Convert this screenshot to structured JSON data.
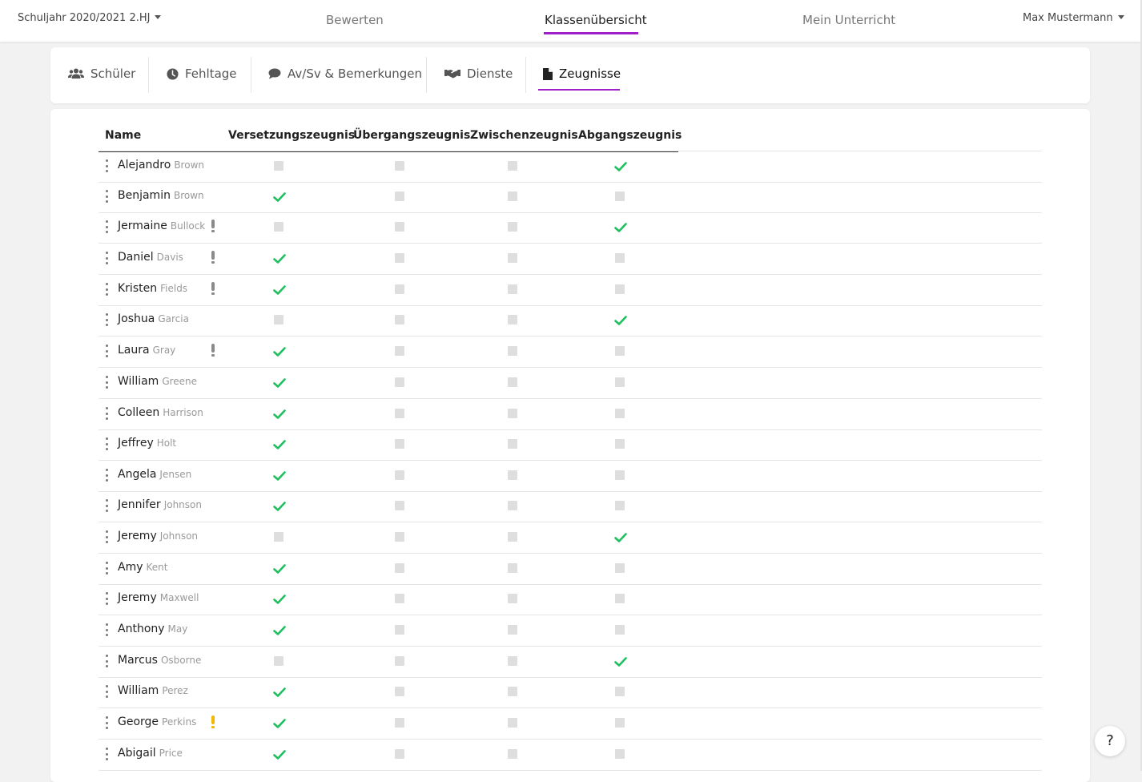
{
  "header": {
    "school_year": "Schuljahr 2020/2021 2.HJ",
    "nav": [
      "Bewerten",
      "Klassenübersicht",
      "Mein Unterricht"
    ],
    "active_nav": "Klassenübersicht",
    "user": "Max Mustermann"
  },
  "tabs": [
    {
      "label": "Schüler",
      "icon": "users-icon"
    },
    {
      "label": "Fehltage",
      "icon": "clock-icon"
    },
    {
      "label": "Av/Sv & Bemerkungen",
      "icon": "comment-icon"
    },
    {
      "label": "Dienste",
      "icon": "handshake-icon"
    },
    {
      "label": "Zeugnisse",
      "icon": "document-icon"
    }
  ],
  "active_tab": "Zeugnisse",
  "table": {
    "columns": [
      "Name",
      "Versetzungszeugnis",
      "Übergangszeugnis",
      "Zwischenzeugnis",
      "Abgangszeugnis"
    ],
    "rows": [
      {
        "first": "Alejandro",
        "last": "Brown",
        "warning": null,
        "certs": [
          false,
          false,
          false,
          true
        ]
      },
      {
        "first": "Benjamin",
        "last": "Brown",
        "warning": null,
        "certs": [
          true,
          false,
          false,
          false
        ]
      },
      {
        "first": "Jermaine",
        "last": "Bullock",
        "warning": "gray",
        "certs": [
          false,
          false,
          false,
          true
        ]
      },
      {
        "first": "Daniel",
        "last": "Davis",
        "warning": "gray",
        "certs": [
          true,
          false,
          false,
          false
        ]
      },
      {
        "first": "Kristen",
        "last": "Fields",
        "warning": "gray",
        "certs": [
          true,
          false,
          false,
          false
        ]
      },
      {
        "first": "Joshua",
        "last": "Garcia",
        "warning": null,
        "certs": [
          false,
          false,
          false,
          true
        ]
      },
      {
        "first": "Laura",
        "last": "Gray",
        "warning": "gray",
        "certs": [
          true,
          false,
          false,
          false
        ]
      },
      {
        "first": "William",
        "last": "Greene",
        "warning": null,
        "certs": [
          true,
          false,
          false,
          false
        ]
      },
      {
        "first": "Colleen",
        "last": "Harrison",
        "warning": null,
        "certs": [
          true,
          false,
          false,
          false
        ]
      },
      {
        "first": "Jeffrey",
        "last": "Holt",
        "warning": null,
        "certs": [
          true,
          false,
          false,
          false
        ]
      },
      {
        "first": "Angela",
        "last": "Jensen",
        "warning": null,
        "certs": [
          true,
          false,
          false,
          false
        ]
      },
      {
        "first": "Jennifer",
        "last": "Johnson",
        "warning": null,
        "certs": [
          true,
          false,
          false,
          false
        ]
      },
      {
        "first": "Jeremy",
        "last": "Johnson",
        "warning": null,
        "certs": [
          false,
          false,
          false,
          true
        ]
      },
      {
        "first": "Amy",
        "last": "Kent",
        "warning": null,
        "certs": [
          true,
          false,
          false,
          false
        ]
      },
      {
        "first": "Jeremy",
        "last": "Maxwell",
        "warning": null,
        "certs": [
          true,
          false,
          false,
          false
        ]
      },
      {
        "first": "Anthony",
        "last": "May",
        "warning": null,
        "certs": [
          true,
          false,
          false,
          false
        ]
      },
      {
        "first": "Marcus",
        "last": "Osborne",
        "warning": null,
        "certs": [
          false,
          false,
          false,
          true
        ]
      },
      {
        "first": "William",
        "last": "Perez",
        "warning": null,
        "certs": [
          true,
          false,
          false,
          false
        ]
      },
      {
        "first": "George",
        "last": "Perkins",
        "warning": "yellow",
        "certs": [
          true,
          false,
          false,
          false
        ]
      },
      {
        "first": "Abigail",
        "last": "Price",
        "warning": null,
        "certs": [
          true,
          false,
          false,
          false
        ]
      }
    ]
  },
  "colors": {
    "accent": "#a020c8",
    "check": "#1fbf5f",
    "warning_gray": "#8a8a8a",
    "warning_yellow": "#f2b705"
  },
  "help": "?"
}
